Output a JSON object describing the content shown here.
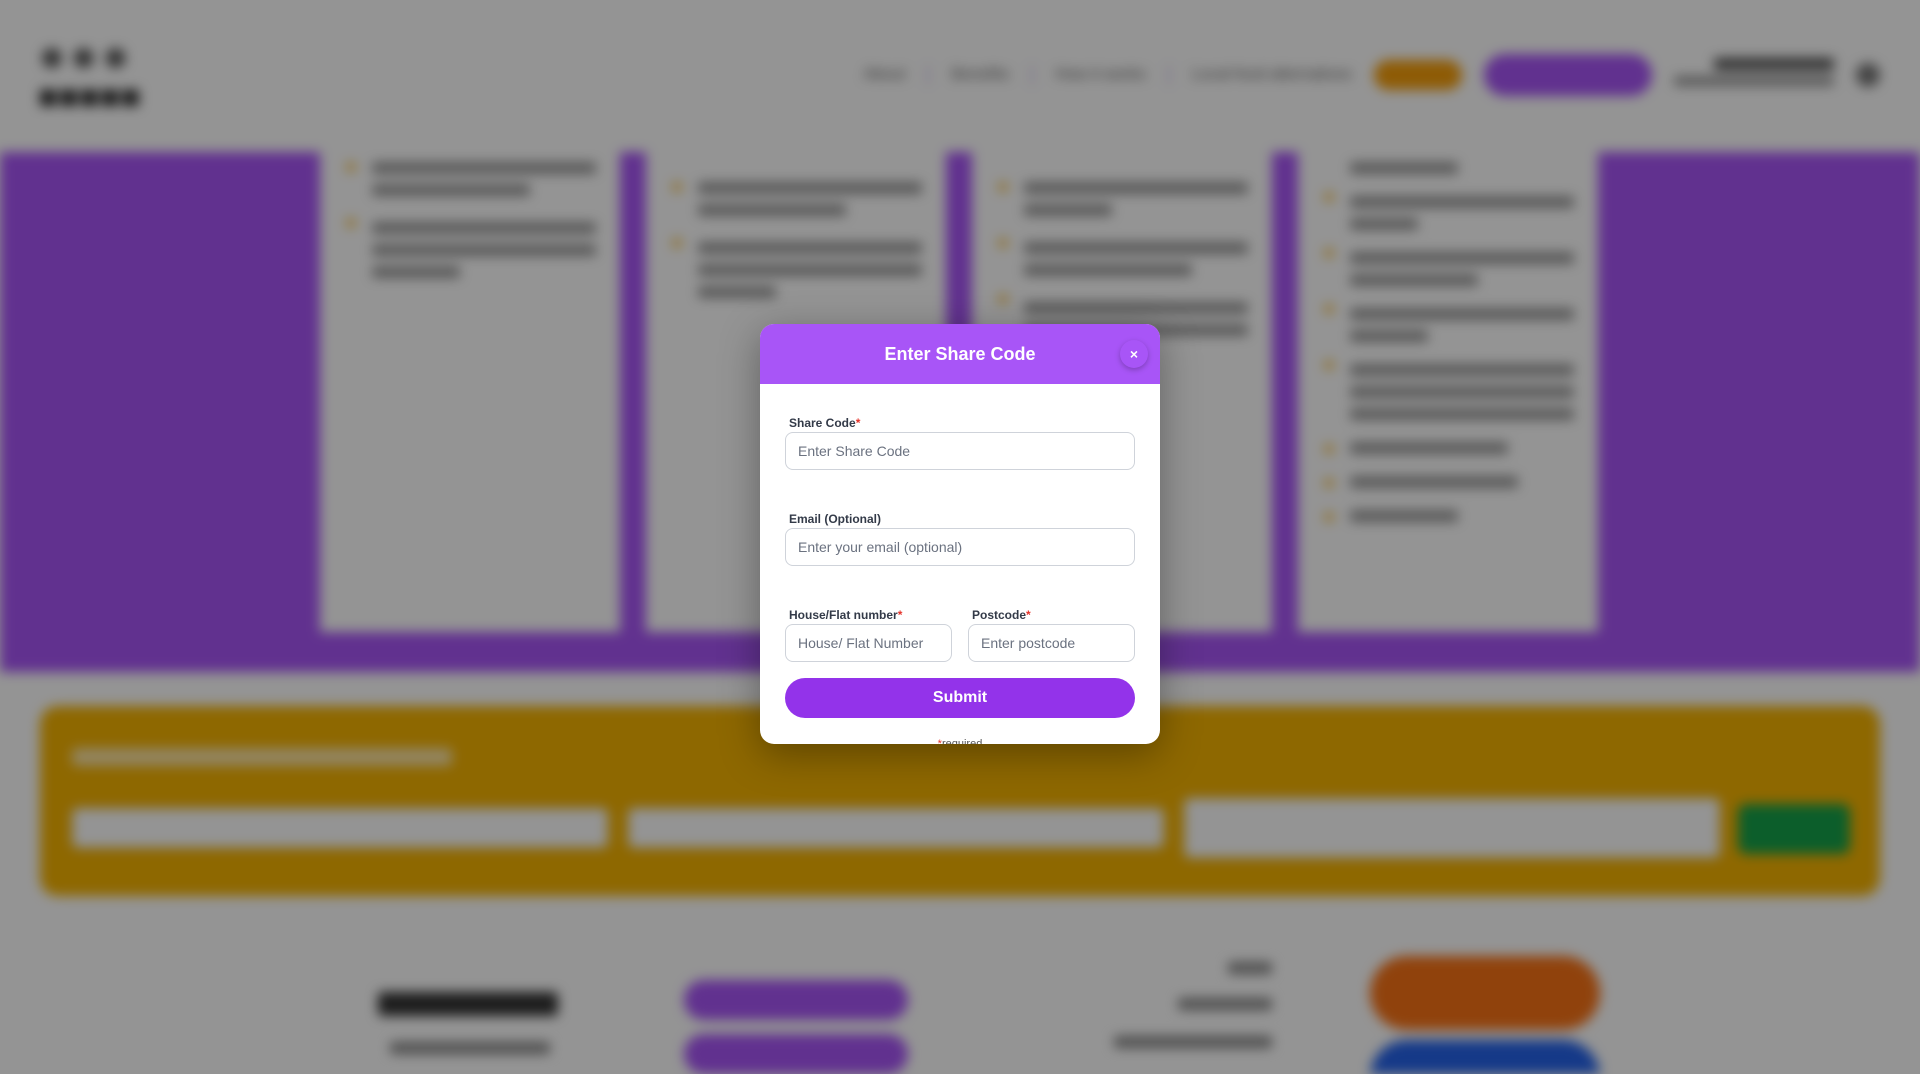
{
  "background": {
    "nav": {
      "links": [
        "About",
        "Benefits",
        "How it works",
        "Local food alternatives"
      ]
    }
  },
  "modal": {
    "title": "Enter Share Code",
    "close_label": "×",
    "fields": {
      "share_code": {
        "label": "Share Code",
        "required_mark": "*",
        "placeholder": "Enter Share Code",
        "value": ""
      },
      "email": {
        "label": "Email (Optional)",
        "placeholder": "Enter your email (optional)",
        "value": ""
      },
      "house": {
        "label": "House/Flat number",
        "required_mark": "*",
        "placeholder": "House/ Flat Number",
        "value": ""
      },
      "postcode": {
        "label": "Postcode",
        "required_mark": "*",
        "placeholder": "Enter postcode",
        "value": ""
      }
    },
    "submit_label": "Submit",
    "required_note": {
      "mark": "*",
      "text": "required"
    }
  },
  "colors": {
    "accent": "#a855f7",
    "button": "#9333ea",
    "required": "#e5332a",
    "banner": "#f5b301",
    "action_green": "#16a34a"
  }
}
